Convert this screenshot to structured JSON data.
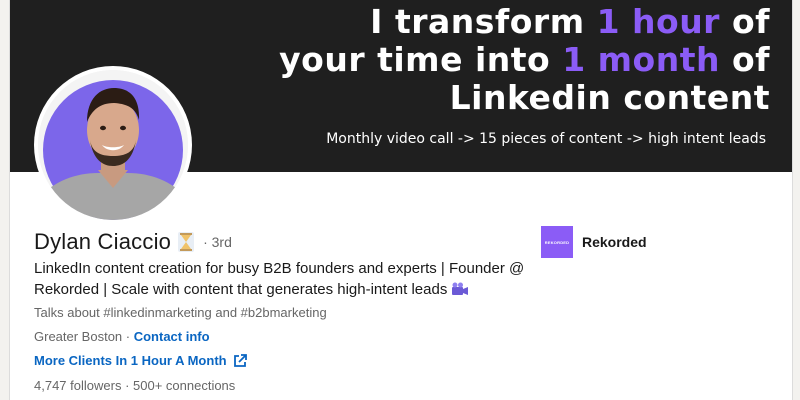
{
  "banner": {
    "line1_pre": "I transform ",
    "line1_hl": "1 hour",
    "line1_post": " of",
    "line2_pre": "your time into ",
    "line2_hl": "1 month",
    "line2_post": " of",
    "line3": "Linkedin content",
    "subtitle": "Monthly video call -> 15 pieces of content -> high intent leads",
    "highlight_color": "#8b5cf6",
    "background_color": "#1f1f1f"
  },
  "profile": {
    "name": "Dylan Ciaccio",
    "status_icon": "hourglass-icon",
    "degree": "· 3rd",
    "headline": "LinkedIn content creation for busy B2B founders and experts | Founder @ Rekorded | Scale with content that generates high-intent leads",
    "headline_icon": "movie-camera-icon",
    "talks_about": "Talks about #linkedinmarketing and #b2bmarketing",
    "location": "Greater Boston",
    "location_separator": " · ",
    "contact_label": "Contact info",
    "link_label": "More Clients In 1 Hour A Month",
    "link_icon": "external-link-icon",
    "followers": "4,747 followers",
    "stats_separator": " · ",
    "connections": "500+ connections"
  },
  "company": {
    "logo_text": "REKORDED",
    "name": "Rekorded",
    "logo_color": "#8b5cf6"
  },
  "colors": {
    "link_blue": "#0a66c2",
    "muted_text": "#666666",
    "primary_text": "#191919"
  }
}
